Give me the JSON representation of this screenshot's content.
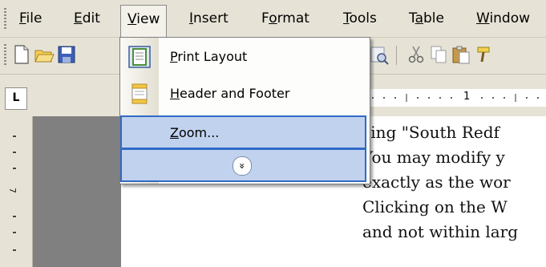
{
  "menubar": {
    "items": [
      {
        "label": "File",
        "accel": "F",
        "rest": "ile"
      },
      {
        "label": "Edit",
        "accel": "E",
        "rest": "dit"
      },
      {
        "label": "View",
        "accel": "V",
        "rest": "iew"
      },
      {
        "label": "Insert",
        "accel": "I",
        "rest": "nsert"
      },
      {
        "label": "Format",
        "pre": "F",
        "accel": "o",
        "rest": "rmat"
      },
      {
        "label": "Tools",
        "accel": "T",
        "rest": "ools"
      },
      {
        "label": "Table",
        "pre": "T",
        "accel": "a",
        "rest": "ble"
      },
      {
        "label": "Window",
        "accel": "W",
        "rest": "indow"
      }
    ]
  },
  "view_menu": {
    "items": [
      {
        "label": "Print Layout",
        "accel": "P",
        "rest": "rint Layout",
        "icon": "print-layout-icon"
      },
      {
        "label": "Header and Footer",
        "accel": "H",
        "rest": "eader and Footer",
        "icon": "header-footer-icon"
      },
      {
        "label": "Zoom...",
        "accel": "Z",
        "rest": "oom..."
      },
      {
        "label": "expand",
        "icon": "chevron-double-down-icon"
      }
    ]
  },
  "ruler": {
    "tab_selector": "L",
    "marker": "1"
  },
  "document": {
    "lines": [
      "sing \"South Redf",
      "You may modify y",
      "exactly as the wor",
      "Clicking on the W",
      "and not within larg"
    ]
  },
  "colors": {
    "chrome": "#e6e3d6",
    "highlight": "#c1d2ee",
    "highlight_border": "#316ac5"
  }
}
